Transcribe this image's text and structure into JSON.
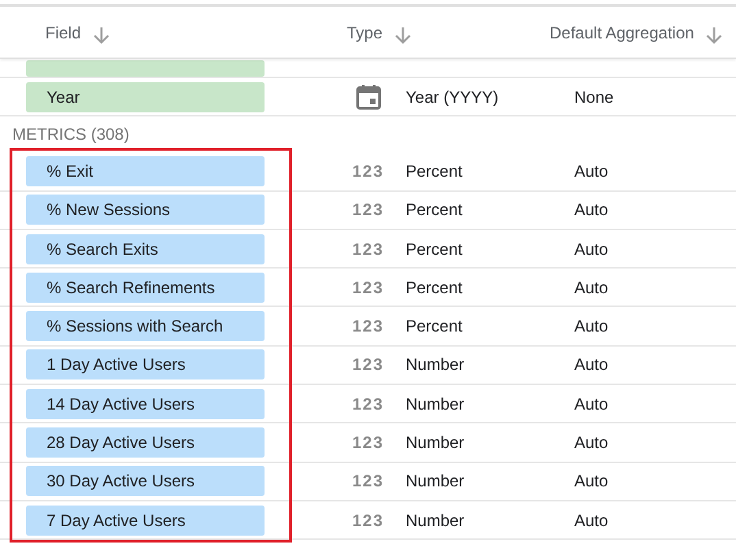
{
  "header": {
    "columns": [
      {
        "label": "Field"
      },
      {
        "label": "Type"
      },
      {
        "label": "Default Aggregation"
      }
    ]
  },
  "sections": [
    {
      "color": "#c8e6c9",
      "rows": [
        {
          "kind": "sliver"
        },
        {
          "field": "Year",
          "kind": "date",
          "type": "Year (YYYY)",
          "aggregation": "None"
        }
      ]
    },
    {
      "title": "METRICS (308)",
      "color": "#bbdefb",
      "highlighted": true,
      "rows": [
        {
          "field": "% Exit",
          "kind": "number",
          "type_icon": "123",
          "type": "Percent",
          "aggregation": "Auto"
        },
        {
          "field": "% New Sessions",
          "kind": "number",
          "type_icon": "123",
          "type": "Percent",
          "aggregation": "Auto"
        },
        {
          "field": "% Search Exits",
          "kind": "number",
          "type_icon": "123",
          "type": "Percent",
          "aggregation": "Auto"
        },
        {
          "field": "% Search Refinements",
          "kind": "number",
          "type_icon": "123",
          "type": "Percent",
          "aggregation": "Auto"
        },
        {
          "field": "% Sessions with Search",
          "kind": "number",
          "type_icon": "123",
          "type": "Percent",
          "aggregation": "Auto"
        },
        {
          "field": "1 Day Active Users",
          "kind": "number",
          "type_icon": "123",
          "type": "Number",
          "aggregation": "Auto"
        },
        {
          "field": "14 Day Active Users",
          "kind": "number",
          "type_icon": "123",
          "type": "Number",
          "aggregation": "Auto"
        },
        {
          "field": "28 Day Active Users",
          "kind": "number",
          "type_icon": "123",
          "type": "Number",
          "aggregation": "Auto"
        },
        {
          "field": "30 Day Active Users",
          "kind": "number",
          "type_icon": "123",
          "type": "Number",
          "aggregation": "Auto"
        },
        {
          "field": "7 Day Active Users",
          "kind": "number",
          "type_icon": "123",
          "type": "Number",
          "aggregation": "Auto"
        }
      ]
    }
  ]
}
